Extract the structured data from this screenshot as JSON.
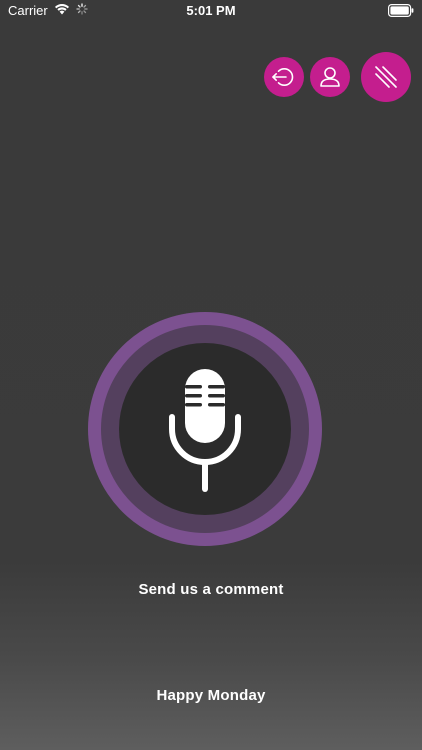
{
  "status_bar": {
    "carrier": "Carrier",
    "time": "5:01 PM",
    "icons": [
      "wifi-icon",
      "loading-spinner-icon",
      "battery-icon"
    ]
  },
  "actions": {
    "logout_icon": "logout-icon",
    "profile_icon": "user-icon",
    "menu_icon": "menu-lines-icon"
  },
  "microphone": {
    "icon": "microphone-icon"
  },
  "labels": {
    "comment": "Send us a comment",
    "greeting": "Happy Monday"
  },
  "colors": {
    "accent": "#c41e8e",
    "ring_outer": "#7c5190",
    "ring_middle": "#54405e",
    "ring_inner": "#2b2b2b",
    "background": "#3a3a3a"
  }
}
